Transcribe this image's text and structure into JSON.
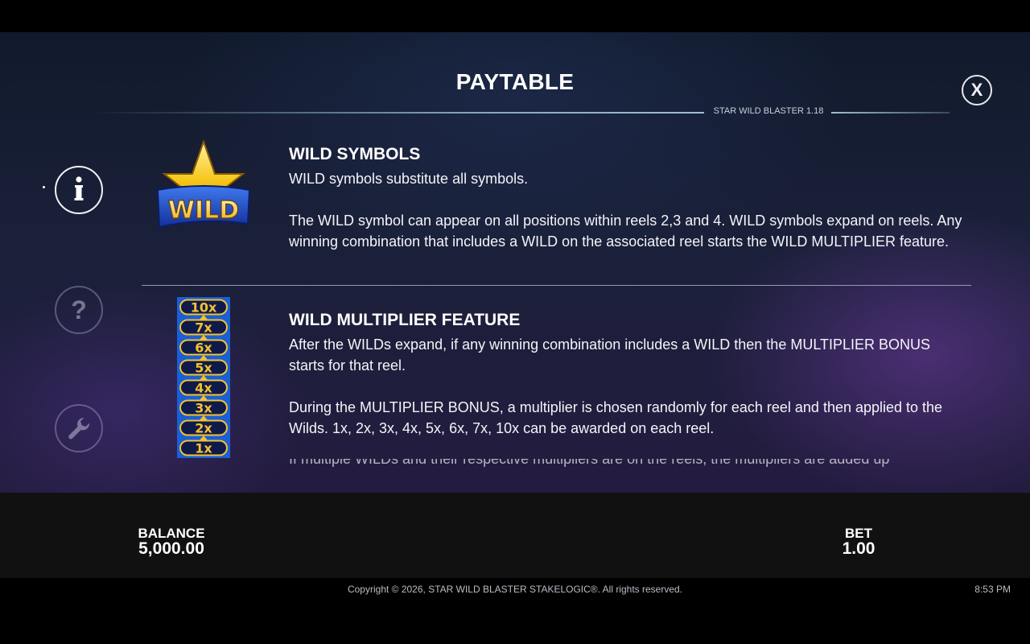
{
  "header": {
    "title": "PAYTABLE",
    "version": "STAR WILD BLASTER 1.18",
    "close_label": "X"
  },
  "side_nav": {
    "items": [
      {
        "icon": "info-icon",
        "active": true
      },
      {
        "icon": "question-icon",
        "active": false
      },
      {
        "icon": "wrench-icon",
        "active": false
      }
    ]
  },
  "sections": {
    "wild": {
      "heading": "WILD SYMBOLS",
      "symbol_text": "WILD",
      "p1": "WILD symbols substitute all symbols.",
      "p2": "The WILD symbol can appear on all positions within reels 2,3 and 4. WILD symbols expand on reels. Any winning combination that includes a WILD on the associated reel starts the WILD MULTIPLIER feature."
    },
    "multiplier": {
      "heading": "WILD MULTIPLIER FEATURE",
      "p1": "After the WILDs expand, if any winning combination includes a WILD then the MULTIPLIER BONUS starts for that reel.",
      "p2": "During the MULTIPLIER BONUS, a multiplier is chosen randomly for each reel and then applied to the Wilds. 1x, 2x, 3x, 4x, 5x, 6x, 7x, 10x can be awarded on each reel.",
      "p3_partial": "If multiple WILDs and their respective multipliers are on the reels, the multipliers are added up",
      "ladder": [
        "10x",
        "7x",
        "6x",
        "5x",
        "4x",
        "3x",
        "2x",
        "1x"
      ]
    }
  },
  "status": {
    "balance_label": "BALANCE",
    "balance_value": "5,000.00",
    "bet_label": "BET",
    "bet_value": "1.00"
  },
  "footer": {
    "copyright": "Copyright © 2026, STAR WILD BLASTER STAKELOGIC®. All rights reserved.",
    "time": "8:53 PM"
  },
  "colors": {
    "ladder_blue": "#1a5fd6",
    "ladder_gold": "#f2c230",
    "star_gold": "#f5c518",
    "wild_banner": "#1d3fa8"
  }
}
